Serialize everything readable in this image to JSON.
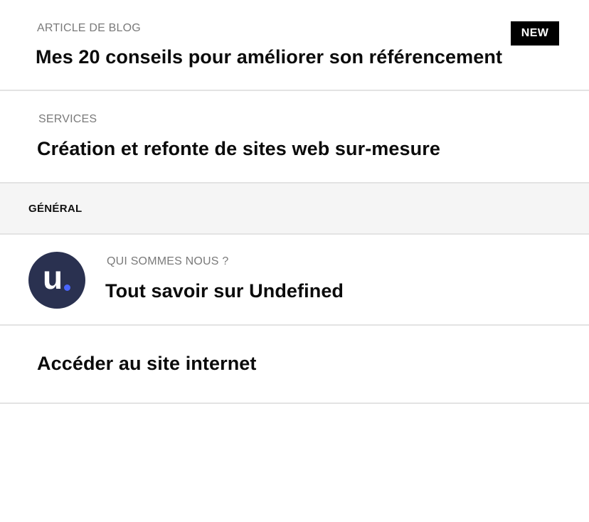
{
  "items": {
    "blog": {
      "kicker": "ARTICLE DE BLOG",
      "title": "Mes 20 conseils pour améliorer son référencement",
      "badge": "NEW"
    },
    "services": {
      "kicker": "SERVICES",
      "title": "Création et refonte de sites web sur-mesure"
    },
    "section_general": {
      "label": "GÉNÉRAL"
    },
    "about": {
      "kicker": "QUI SOMMES NOUS ?",
      "title": "Tout savoir sur Undefined",
      "avatar_letter": "u",
      "avatar_bg": "#2a3150",
      "avatar_dot": "#4a66ff"
    },
    "site": {
      "title": "Accéder au site internet"
    }
  }
}
